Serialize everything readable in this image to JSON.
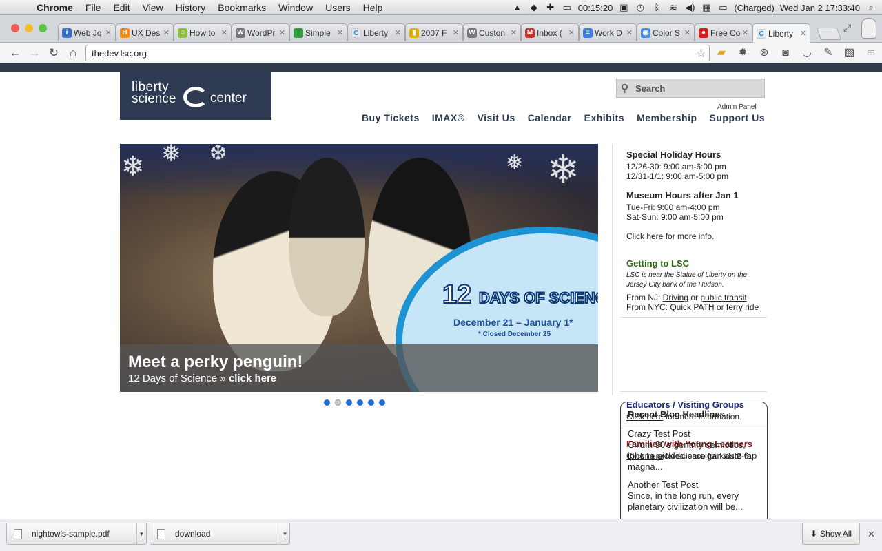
{
  "menubar": {
    "app": "Chrome",
    "items": [
      "File",
      "Edit",
      "View",
      "History",
      "Bookmarks",
      "Window",
      "Users",
      "Help"
    ],
    "battery_time": "00:15:20",
    "battery_status": "(Charged)",
    "datetime": "Wed Jan 2  17:33:40"
  },
  "tabs": [
    {
      "label": "Web Jo",
      "color": "#3a6fc4",
      "glyph": "i"
    },
    {
      "label": "UX Des",
      "color": "#f0891a",
      "glyph": "H"
    },
    {
      "label": "How to",
      "color": "#8cbf3f",
      "glyph": "☺"
    },
    {
      "label": "WordPr",
      "color": "#777777",
      "glyph": "W"
    },
    {
      "label": "Simple",
      "color": "#2f9a3e",
      "glyph": ""
    },
    {
      "label": "Liberty",
      "color": "#e8e8e8",
      "glyph": "C"
    },
    {
      "label": "2007 F",
      "color": "#e0b000",
      "glyph": "▮"
    },
    {
      "label": "Custon",
      "color": "#777777",
      "glyph": "W"
    },
    {
      "label": "Inbox (",
      "color": "#c8322a",
      "glyph": "M"
    },
    {
      "label": "Work D",
      "color": "#3b7de0",
      "glyph": "≡"
    },
    {
      "label": "Color S",
      "color": "#4a90e2",
      "glyph": "◉"
    },
    {
      "label": "Free Co",
      "color": "#d61d1d",
      "glyph": "●"
    },
    {
      "label": "Liberty",
      "color": "#e8e8e8",
      "glyph": "C",
      "active": true
    }
  ],
  "toolbar": {
    "url": "thedev.lsc.org"
  },
  "site": {
    "logo": {
      "line1": "liberty",
      "line2": "science",
      "line3": "center"
    },
    "search_placeholder": "Search",
    "admin_panel": "Admin Panel",
    "nav": [
      "Buy Tickets",
      "IMAX®",
      "Visit Us",
      "Calendar",
      "Exhibits",
      "Membership",
      "Support Us"
    ]
  },
  "hero": {
    "badge_line1": "12",
    "badge_line2": "DAYS OF SCIENCE",
    "dates": "December 21 – January 1*",
    "closed": "* Closed December 25",
    "caption_title": "Meet a perky penguin!",
    "caption_sub": "12 Days of Science",
    "caption_link": "click here",
    "dots_total": 6,
    "dots_active": 1
  },
  "sidebar": {
    "holiday_title": "Special Holiday Hours",
    "holiday_lines": [
      "12/26-30: 9:00 am-6:00 pm",
      "12/31-1/1: 9:00 am-5:00 pm"
    ],
    "hours_title": "Museum Hours after Jan 1",
    "hours_lines": [
      "Tue-Fri: 9:00 am-4:00 pm",
      "Sat-Sun: 9:00 am-5:00 pm"
    ],
    "more_link": "Click here",
    "more_text": " for more info.",
    "getting_title": "Getting to LSC",
    "getting_note": "LSC is near the Statue of Liberty on the Jersey City bank of the Hudson.",
    "nj_prefix": "From NJ: ",
    "nj_link1": "Driving",
    "nj_or": " or ",
    "nj_link2": "public transit",
    "nyc_prefix": "From NYC: Quick ",
    "nyc_link1": "PATH",
    "nyc_or": " or ",
    "nyc_link2": "ferry ride",
    "edu_title": "Educators / Visiting Groups",
    "edu_link": "Click here",
    "edu_text": " for more information.",
    "fam_title": "Families with Young Learners",
    "fam_link": "Click here",
    "fam_text": " for science for kids 2-6.",
    "colors": {
      "getting": "#2a6a12",
      "edu": "#1b2a7a",
      "fam": "#8a1c1c"
    }
  },
  "blog": {
    "title": "Recent Blog Headlines",
    "posts": [
      {
        "title": "Crazy Test Post",
        "excerpt": "Cillum 90's gentrify semiotics, iphone pickled cardigan aute fap magna..."
      },
      {
        "title": "Another Test Post",
        "excerpt": "Since, in the long run, every planetary civilization will be..."
      }
    ]
  },
  "downloads": {
    "items": [
      "nightowls-sample.pdf",
      "download"
    ],
    "show_all": "Show All"
  }
}
